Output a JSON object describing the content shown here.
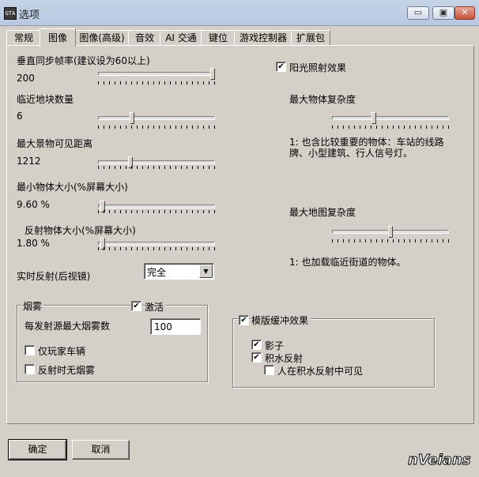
{
  "window": {
    "title": "选项",
    "app_icon_text": "GTA",
    "min": "▭",
    "max": "▣",
    "close": "✕"
  },
  "tabs": [
    "常规",
    "图像",
    "图像(高级)",
    "音效",
    "AI 交通",
    "键位",
    "游戏控制器",
    "扩展包"
  ],
  "left": {
    "vsync_label": "垂直同步帧率(建议设为60以上)",
    "vsync_value": "200",
    "vsync_level": 1.0,
    "blocks_label": "临近地块数量",
    "blocks_value": "6",
    "blocks_level": 0.28,
    "scenery_label": "最大景物可见距离",
    "scenery_value": "1212",
    "scenery_level": 0.27,
    "minobj_label": "最小物体大小(%屏幕大小)",
    "minobj_value": "9.60 %",
    "minobj_level": 0.02,
    "reflobj_label": "反射物体大小(%屏幕大小)",
    "reflobj_value": "1.80 %",
    "reflobj_level": 0.02,
    "realtime_label": "实时反射(后视镜)",
    "realtime_value": "完全"
  },
  "right": {
    "sun_label": "阳光照射效果",
    "sun_checked": "✔",
    "objcx_label": "最大物体复杂度",
    "objcx_level": 0.35,
    "objcx_desc1": "1: 也含比较重要的物体：车站的线路",
    "objcx_desc2": "牌、小型建筑、行人信号灯。",
    "mapcx_label": "最大地图复杂度",
    "mapcx_level": 0.5,
    "mapcx_desc": "1: 也加载临近街道的物体。"
  },
  "fog": {
    "title": "烟雾",
    "activate_label": "激活",
    "activate_checked": "✔",
    "max_label": "每发射源最大烟雾数",
    "max_value": "100",
    "player_only_label": "仅玩家车辆",
    "no_reflect_label": "反射时无烟雾"
  },
  "stencil": {
    "title": "模版缓冲效果",
    "checked": "✔",
    "shadow_label": "影子",
    "shadow_checked": "✔",
    "water_label": "积水反射",
    "water_checked": "✔",
    "water_player_label": "人在积水反射中可见"
  },
  "buttons": {
    "ok": "确定",
    "cancel": "取消"
  },
  "logo": "nVeians"
}
